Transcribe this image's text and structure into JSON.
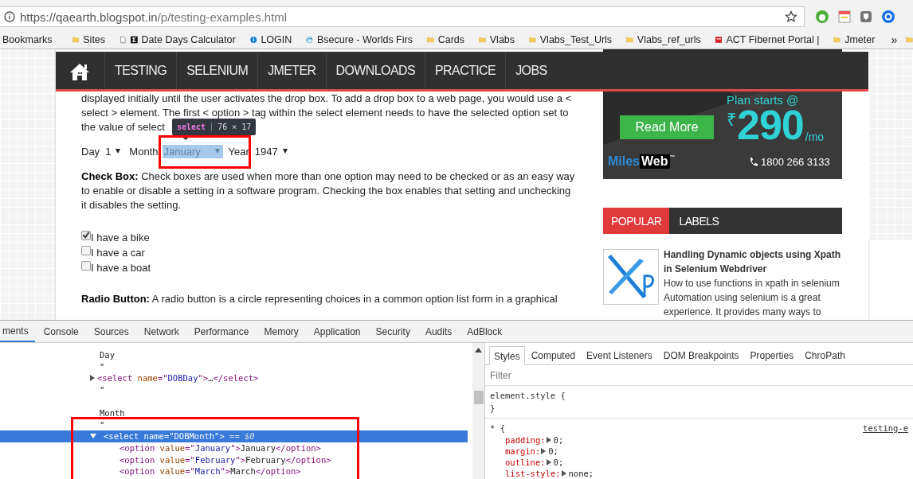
{
  "browser": {
    "url_host": "https://qaearth.blogspot.in",
    "url_path": "/p/testing-examples.html",
    "bookmarks": [
      {
        "label": "Bookmarks",
        "kind": "plain"
      },
      {
        "label": "Sites",
        "kind": "folder"
      },
      {
        "kind": "page"
      },
      {
        "label": "Date Days Calculator",
        "kind": "sigma"
      },
      {
        "label": "LOGIN",
        "kind": "login"
      },
      {
        "label": "Bsecure - Worlds Firs",
        "kind": "globe"
      },
      {
        "label": "Cards",
        "kind": "folder"
      },
      {
        "label": "Vlabs",
        "kind": "folder"
      },
      {
        "label": "Vlabs_Test_Urls",
        "kind": "folder"
      },
      {
        "label": "Vlabs_ref_urls",
        "kind": "folder"
      },
      {
        "label": "ACT Fibernet Portal |",
        "kind": "act"
      },
      {
        "label": "Jmeter",
        "kind": "folder"
      }
    ],
    "overflow": "»"
  },
  "site_nav": {
    "items": [
      "TESTING",
      "SELENIUM",
      "JMETER",
      "DOWNLOADS",
      "PRACTICE",
      "JOBS"
    ]
  },
  "article": {
    "dropdown_text": [
      "displayed initially until the user activates the drop box. To add a drop box to a web page, you would use a <",
      "select > element. The first < option > tag within the select element needs to have the selected option set to",
      "the value of select"
    ],
    "selects": [
      {
        "label": "Day",
        "value": "1",
        "inspected": false
      },
      {
        "label": "Month",
        "value": "January",
        "inspected": true
      },
      {
        "label": "Year",
        "value": "1947",
        "inspected": false
      }
    ],
    "inspector_tooltip": {
      "tag": "select",
      "size": "76 × 17"
    },
    "checkbox_text": [
      "**Check Box:** Check boxes are used when more than one option may need to be checked or as an easy way",
      "to enable or disable a setting in a software program. Checking the box enables that setting and unchecking",
      "it disables the setting."
    ],
    "checkboxes": [
      {
        "label": "I have a bike",
        "checked": true
      },
      {
        "label": "I have a car",
        "checked": false
      },
      {
        "label": "I have a boat",
        "checked": false
      }
    ],
    "radio_text": [
      "**Radio Button:** A radio button is a circle representing choices in a common option list form in a graphical"
    ]
  },
  "sidebar": {
    "ad": {
      "button": "Read More",
      "headline": "Plan starts @",
      "currency": "₹",
      "price": "290",
      "unit": "/mo",
      "brand_a": "Miles",
      "brand_b": "Web",
      "trademark": "™",
      "phone": "1800 266 3133"
    },
    "tabs": [
      {
        "label": "POPULAR",
        "selected": true
      },
      {
        "label": "LABELS",
        "selected": false
      }
    ],
    "post": {
      "title": "Handling Dynamic objects using Xpath in Selenium Webdriver",
      "snippet": "How to use functions in xpath in selenium Automation using selenium is a great experience. It provides many ways to"
    }
  },
  "devtools": {
    "tabs": [
      {
        "label": "ments",
        "selected": true
      },
      {
        "label": "Console",
        "selected": false
      },
      {
        "label": "Sources",
        "selected": false
      },
      {
        "label": "Network",
        "selected": false
      },
      {
        "label": "Performance",
        "selected": false
      },
      {
        "label": "Memory",
        "selected": false
      },
      {
        "label": "Application",
        "selected": false
      },
      {
        "label": "Security",
        "selected": false
      },
      {
        "label": "Audits",
        "selected": false
      },
      {
        "label": "AdBlock",
        "selected": false
      }
    ],
    "dom": [
      {
        "kind": "text",
        "tokens": [
          {
            "kind": "plain",
            "t": "Day"
          }
        ]
      },
      {
        "kind": "text",
        "tokens": [
          {
            "kind": "plain",
            "t": "\""
          }
        ]
      },
      {
        "kind": "element",
        "expanded": false,
        "selected": false,
        "tokens": [
          {
            "kind": "tag",
            "t": "<select"
          },
          {
            "kind": "attr",
            "t": " name"
          },
          {
            "kind": "tag",
            "t": "=\""
          },
          {
            "kind": "value",
            "t": "DOBDay"
          },
          {
            "kind": "tag",
            "t": "\">"
          },
          {
            "kind": "plain",
            "t": "…"
          },
          {
            "kind": "tag",
            "t": "</select>"
          }
        ]
      },
      {
        "kind": "text",
        "tokens": [
          {
            "kind": "plain",
            "t": "\""
          }
        ]
      },
      {
        "kind": "blank"
      },
      {
        "kind": "text",
        "tokens": [
          {
            "kind": "plain",
            "t": "Month"
          }
        ]
      },
      {
        "kind": "text",
        "tokens": [
          {
            "kind": "plain",
            "t": "\""
          }
        ]
      },
      {
        "kind": "element",
        "expanded": true,
        "selected": true,
        "tokens": [
          {
            "kind": "tag",
            "t": "<select"
          },
          {
            "kind": "attr",
            "t": " name"
          },
          {
            "kind": "tag",
            "t": "=\""
          },
          {
            "kind": "value",
            "t": "DOBMonth"
          },
          {
            "kind": "tag",
            "t": "\">"
          },
          {
            "kind": "marker",
            "t": " == $0"
          }
        ],
        "children": [
          {
            "kind": "leaf",
            "selected": false,
            "tokens": [
              {
                "kind": "tag",
                "t": "<option"
              },
              {
                "kind": "attr",
                "t": " value"
              },
              {
                "kind": "tag",
                "t": "=\""
              },
              {
                "kind": "value",
                "t": "January"
              },
              {
                "kind": "tag",
                "t": "\">"
              },
              {
                "kind": "plain",
                "t": "January"
              },
              {
                "kind": "tag",
                "t": "</option>"
              }
            ]
          },
          {
            "kind": "leaf",
            "selected": false,
            "tokens": [
              {
                "kind": "tag",
                "t": "<option"
              },
              {
                "kind": "attr",
                "t": " value"
              },
              {
                "kind": "tag",
                "t": "=\""
              },
              {
                "kind": "value",
                "t": "February"
              },
              {
                "kind": "tag",
                "t": "\">"
              },
              {
                "kind": "plain",
                "t": "February"
              },
              {
                "kind": "tag",
                "t": "</option>"
              }
            ]
          },
          {
            "kind": "leaf",
            "selected": false,
            "tokens": [
              {
                "kind": "tag",
                "t": "<option"
              },
              {
                "kind": "attr",
                "t": " value"
              },
              {
                "kind": "tag",
                "t": "=\""
              },
              {
                "kind": "value",
                "t": "March"
              },
              {
                "kind": "tag",
                "t": "\">"
              },
              {
                "kind": "plain",
                "t": "March"
              },
              {
                "kind": "tag",
                "t": "</option>"
              }
            ]
          }
        ]
      }
    ],
    "side_tabs": [
      {
        "label": "Styles",
        "selected": true
      },
      {
        "label": "Computed",
        "selected": false
      },
      {
        "label": "Event Listeners",
        "selected": false
      },
      {
        "label": "DOM Breakpoints",
        "selected": false
      },
      {
        "label": "Properties",
        "selected": false
      },
      {
        "label": "ChroPath",
        "selected": false
      }
    ],
    "filter": {
      "placeholder": "Filter"
    },
    "rules": [
      {
        "selector": "element.style",
        "open": "{",
        "close": "}"
      },
      {
        "selector": "*",
        "open": "{",
        "source": "testing-e",
        "props": [
          {
            "name": "padding:",
            "value": "0;"
          },
          {
            "name": "margin:",
            "value": "0;"
          },
          {
            "name": "outline:",
            "value": "0;"
          },
          {
            "name": "list-style:",
            "value": "none;"
          }
        ]
      }
    ]
  }
}
